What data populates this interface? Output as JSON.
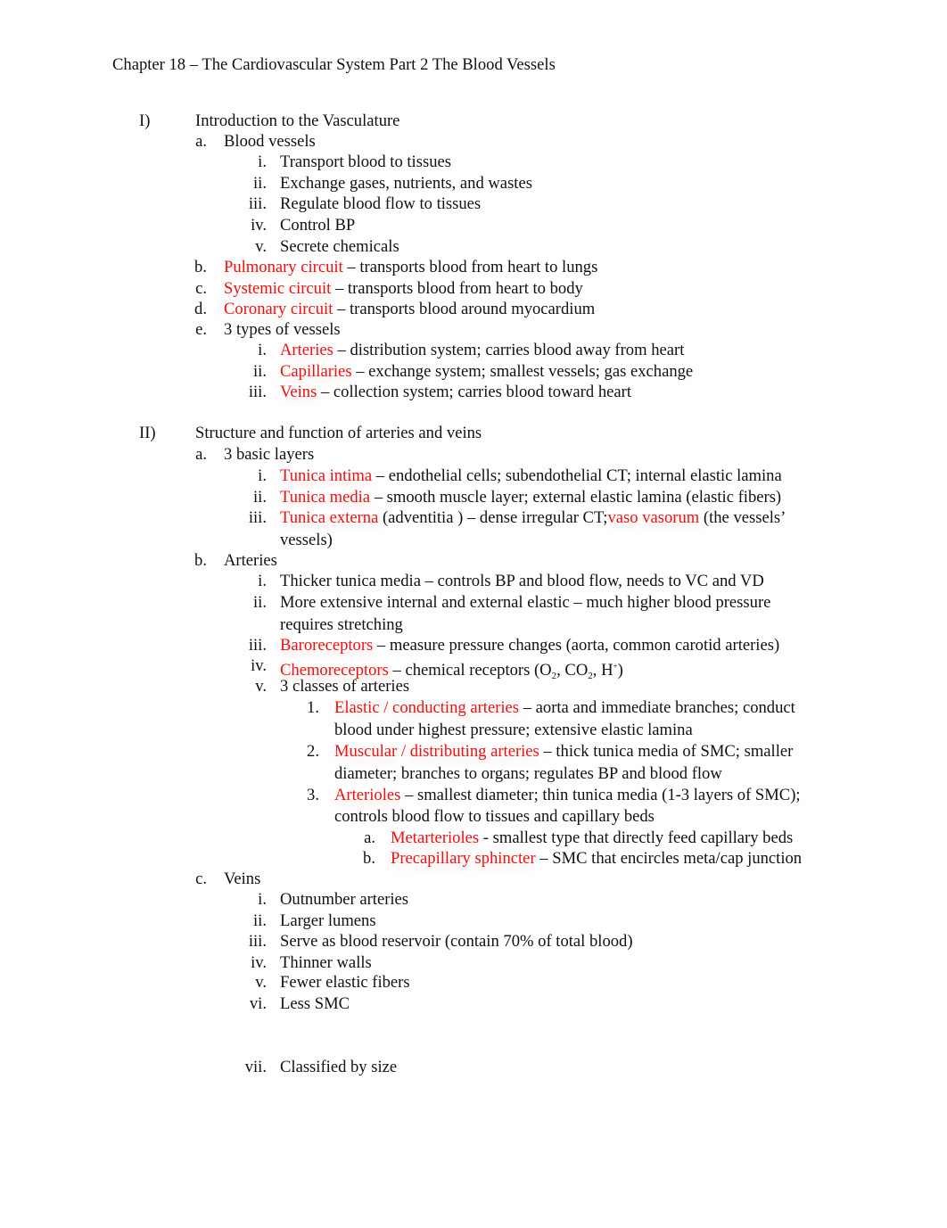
{
  "document": {
    "title": "Chapter 18 – The Cardiovascular System Part 2 The Blood Vessels",
    "accent_color": "#ee1111",
    "sections": [
      {
        "marker": "I)",
        "heading": "Introduction to the Vasculature",
        "items": [
          {
            "marker": "a.",
            "text": "Blood vessels"
          },
          {
            "marker": "i.",
            "text": "Transport blood to tissues"
          },
          {
            "marker": "ii.",
            "text": "Exchange gases, nutrients, and wastes"
          },
          {
            "marker": "iii.",
            "text": "Regulate blood flow to tissues"
          },
          {
            "marker": "iv.",
            "text": "Control BP"
          },
          {
            "marker": "v.",
            "text": "Secrete chemicals"
          },
          {
            "marker": "b.",
            "term": "Pulmonary circuit",
            "text": " – transports blood from heart to lungs"
          },
          {
            "marker": "c.",
            "term": "Systemic circuit",
            "text": " – transports blood from heart to body"
          },
          {
            "marker": "d.",
            "term": "Coronary circuit",
            "text": " – transports blood around myocardium"
          },
          {
            "marker": "e.",
            "text": "3 types of vessels"
          },
          {
            "marker": "i.",
            "term": "Arteries",
            "text": " – distribution system; carries blood away from heart"
          },
          {
            "marker": "ii.",
            "term": "Capillaries",
            "text": " – exchange system; smallest vessels; gas exchange"
          },
          {
            "marker": "iii.",
            "term": "Veins",
            "text": " – collection system; carries blood toward heart"
          }
        ]
      },
      {
        "marker": "II)",
        "heading": "Structure and function of arteries and veins",
        "items": [
          {
            "marker": "a.",
            "text": "3 basic layers"
          },
          {
            "marker": "i.",
            "term": "Tunica intima",
            "text": " – endothelial cells; subendothelial CT; internal elastic lamina"
          },
          {
            "marker": "ii.",
            "term": "Tunica media",
            "text": "  – smooth muscle layer; external elastic lamina (elastic fibers)"
          },
          {
            "marker": "iii.",
            "term": "Tunica externa",
            "text": "  (adventitia ) – dense irregular CT;",
            "term2": "vaso vasorum",
            "text2": "  (the vessels’",
            "cont": "vessels)"
          },
          {
            "marker": "b.",
            "text": "Arteries"
          },
          {
            "marker": "i.",
            "text": "Thicker tunica media  – controls BP and blood flow, needs to VC and VD"
          },
          {
            "marker": "ii.",
            "text": "More extensive internal and external elastic     – much higher blood pressure",
            "cont": "requires stretching"
          },
          {
            "marker": "iii.",
            "term": "Baroreceptors",
            "text": "   – measure pressure changes (aorta, common carotid arteries)"
          },
          {
            "marker": "iv.",
            "term": "Chemoreceptors",
            "text": "   – chemical receptors (O",
            "sub1": "2",
            "text_b": ", CO",
            "sub2": "2",
            "text_c": ", H",
            "sup1": "+",
            "text_d": ")"
          },
          {
            "marker": "v.",
            "text": "3 classes of arteries"
          },
          {
            "marker": "1.",
            "term": "Elastic / conducting arteries",
            "text": "   – aorta and immediate branches; conduct",
            "cont": "blood under highest pressure; extensive elastic lamina"
          },
          {
            "marker": "2.",
            "term": "Muscular / distributing arteries",
            "text": "    – thick tunica media of SMC; smaller",
            "cont": "diameter; branches to organs; regulates BP and blood flow"
          },
          {
            "marker": "3.",
            "term": "Arterioles",
            "text": " – smallest diameter; thin tunica media (1-3 layers of SMC);",
            "cont": "controls blood flow to tissues and  capillary beds"
          },
          {
            "marker": "a.",
            "term": "Metarterioles",
            "text": "   - smallest type that directly feed capillary beds"
          },
          {
            "marker": "b.",
            "term": "Precapillary sphincter",
            "text": "   – SMC that encircles meta/cap junction"
          },
          {
            "marker": "c.",
            "text": "Veins"
          },
          {
            "marker": "i.",
            "text": "Outnumber arteries"
          },
          {
            "marker": "ii.",
            "text": "Larger lumens"
          },
          {
            "marker": "iii.",
            "text": "Serve as blood reservoir  (contain 70% of total blood)"
          },
          {
            "marker": "iv.",
            "text": "Thinner walls"
          },
          {
            "marker": "v.",
            "text": "Fewer elastic fibers"
          },
          {
            "marker": "vi.",
            "text": "Less SMC"
          },
          {
            "marker": "vii.",
            "text": "Classified by size"
          }
        ]
      }
    ]
  }
}
